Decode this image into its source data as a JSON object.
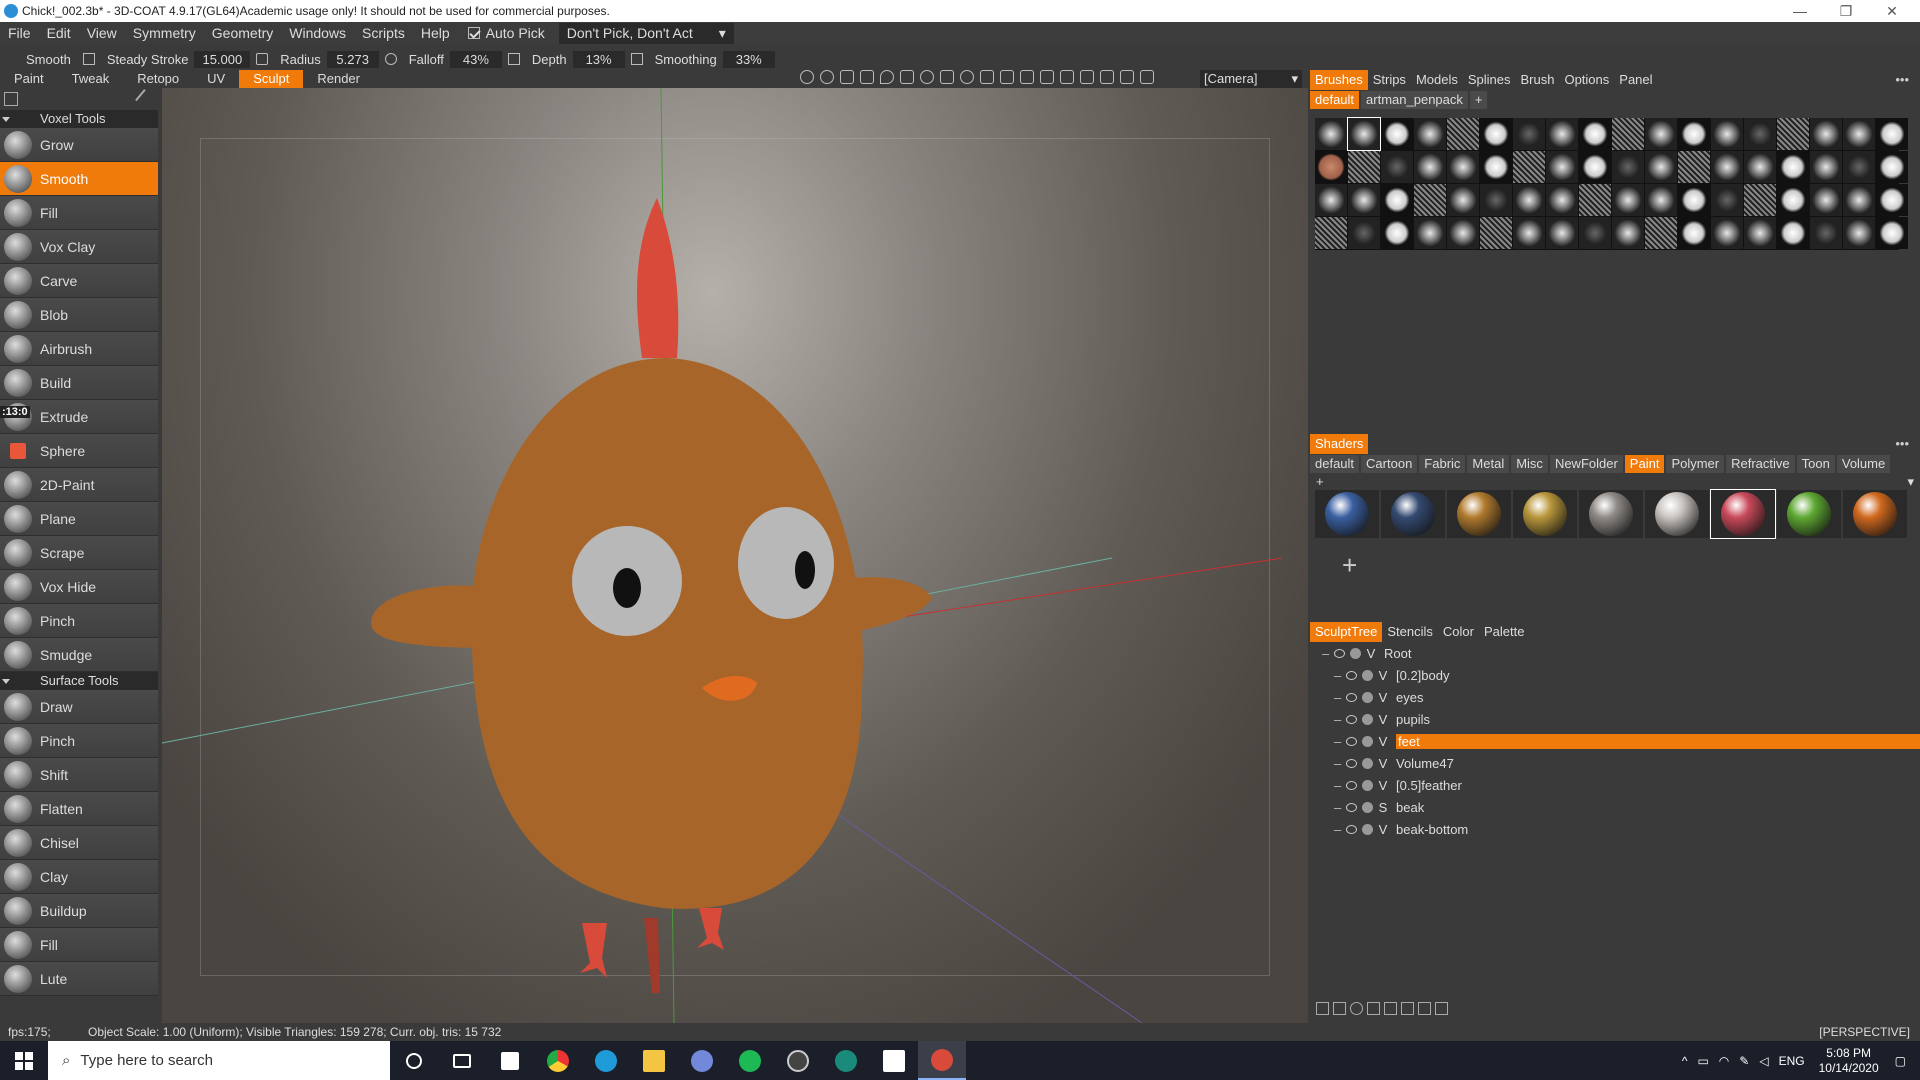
{
  "window": {
    "title": "Chick!_002.3b* - 3D-COAT 4.9.17(GL64)Academic usage only! It should not be used for commercial purposes."
  },
  "menu": {
    "items": [
      "File",
      "Edit",
      "View",
      "Symmetry",
      "Geometry",
      "Windows",
      "Scripts",
      "Help"
    ],
    "auto_pick": "Auto Pick",
    "pick_mode": "Don't Pick, Don't Act"
  },
  "toolbar": {
    "tool_name": "Smooth",
    "steady_stroke": "Steady Stroke",
    "steady_value": "15.000",
    "radius_label": "Radius",
    "radius_value": "5.273",
    "falloff_label": "Falloff",
    "falloff_value": "43%",
    "depth_label": "Depth",
    "depth_value": "13%",
    "smoothing_label": "Smoothing",
    "smoothing_value": "33%"
  },
  "room_tabs": [
    "Paint",
    "Tweak",
    "Retopo",
    "UV",
    "Sculpt",
    "Render"
  ],
  "active_room": "Sculpt",
  "camera_select": "[Camera]",
  "left_panel": {
    "timer": ":13:0",
    "voxel_section": "Voxel Tools",
    "voxel_tools": [
      "Grow",
      "Smooth",
      "Fill",
      "Vox Clay",
      "Carve",
      "Blob",
      "Airbrush",
      "Build",
      "Extrude",
      "Sphere",
      "2D-Paint",
      "Plane",
      "Scrape",
      "Vox Hide",
      "Pinch",
      "Smudge"
    ],
    "active_tool": "Smooth",
    "surface_section": "Surface Tools",
    "surface_tools": [
      "Draw",
      "Pinch",
      "Shift",
      "Flatten",
      "Chisel",
      "Clay",
      "Buildup",
      "Fill",
      "Lute"
    ]
  },
  "brushes_panel": {
    "tabs": [
      "Brushes",
      "Strips",
      "Models",
      "Splines",
      "Brush",
      "Options",
      "Panel"
    ],
    "active_tab": "Brushes",
    "packs": [
      "default",
      "artman_penpack"
    ],
    "active_pack": "default"
  },
  "shaders_panel": {
    "title": "Shaders",
    "categories": [
      "default",
      "Cartoon",
      "Fabric",
      "Metal",
      "Misc",
      "NewFolder",
      "Paint",
      "Polymer",
      "Refractive",
      "Toon",
      "Volume"
    ],
    "active_category": "Paint",
    "swatch_colors": [
      "#3a5fa0",
      "#344a72",
      "#b07a2e",
      "#b8963a",
      "#8f8a86",
      "#c9c4c0",
      "#c9495a",
      "#5ea832",
      "#d0681e"
    ]
  },
  "sculpt_tree": {
    "tabs": [
      "SculptTree",
      "Stencils",
      "Color",
      "Palette"
    ],
    "active_tab": "SculptTree",
    "items": [
      {
        "flag": "V",
        "name": "Root",
        "tag": ""
      },
      {
        "flag": "V",
        "name": "body",
        "tag": "[0.2]"
      },
      {
        "flag": "V",
        "name": "eyes",
        "tag": ""
      },
      {
        "flag": "V",
        "name": "pupils",
        "tag": ""
      },
      {
        "flag": "V",
        "name": "feet",
        "tag": ""
      },
      {
        "flag": "V",
        "name": "Volume47",
        "tag": ""
      },
      {
        "flag": "V",
        "name": "feather",
        "tag": "[0.5]"
      },
      {
        "flag": "S",
        "name": "beak",
        "tag": ""
      },
      {
        "flag": "V",
        "name": "beak-bottom",
        "tag": ""
      }
    ],
    "selected": "feet"
  },
  "status": {
    "fps": "fps:175;",
    "info": "Object Scale: 1.00 (Uniform); Visible Triangles: 159 278; Curr. obj. tris: 15 732",
    "view_mode": "[PERSPECTIVE]"
  },
  "taskbar": {
    "search_placeholder": "Type here to search",
    "language": "ENG",
    "time": "5:08 PM",
    "date": "10/14/2020"
  },
  "colors": {
    "accent": "#f07a0a",
    "panel_bg": "#3a3a3a",
    "chick_body": "#a8652a",
    "comb": "#d84a3a",
    "beak": "#e06a20"
  }
}
